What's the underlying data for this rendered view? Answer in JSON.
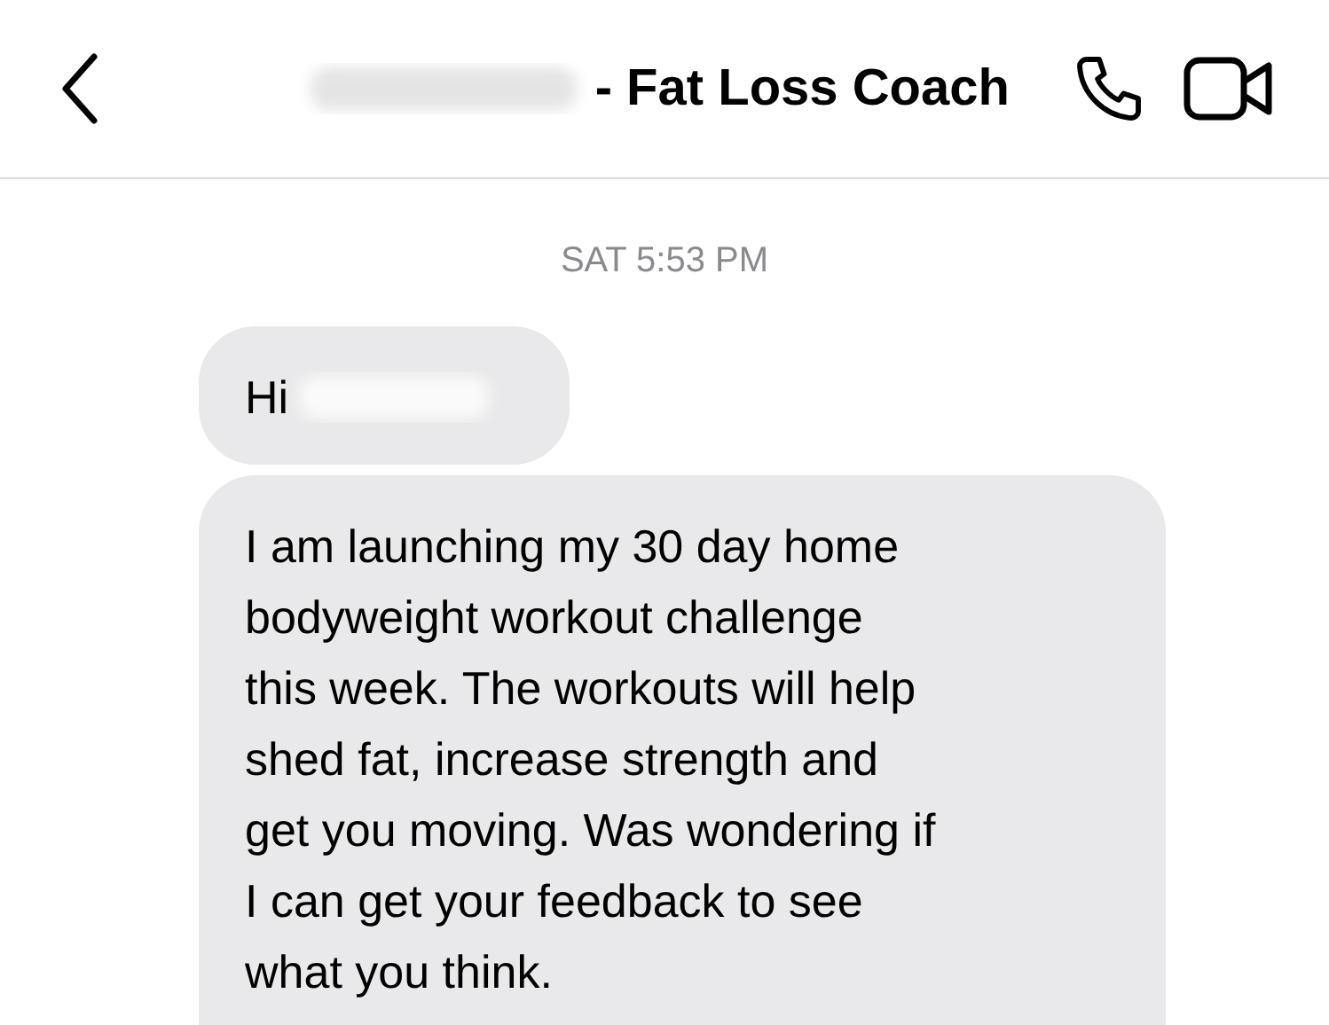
{
  "header": {
    "title": "- Fat Loss Coach"
  },
  "timestamp": "SAT 5:53 PM",
  "messages": [
    {
      "lines": [
        "Hi"
      ],
      "redacted": true
    },
    {
      "lines": [
        "I am launching my 30 day home",
        "bodyweight workout challenge",
        "this week. The workouts will help",
        "shed fat, increase strength and",
        "get you moving. Was wondering if",
        "I can get your feedback to see",
        "what you think."
      ],
      "redacted": false
    }
  ]
}
